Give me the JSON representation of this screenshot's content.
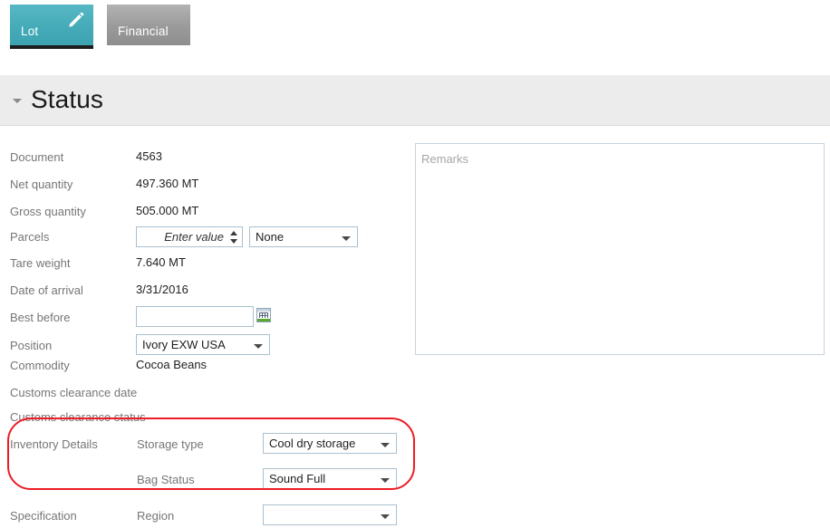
{
  "tabs": [
    {
      "label": "Lot",
      "icon": "pencil-icon",
      "active": true,
      "accent": "#45abb8"
    },
    {
      "label": "Financial",
      "active": false,
      "accent": "#9a9a9a"
    }
  ],
  "section": {
    "title": "Status",
    "caret": "chevron-down-icon",
    "expanded": true
  },
  "fields": {
    "document": {
      "label": "Document",
      "value": "4563"
    },
    "net_quantity": {
      "label": "Net quantity",
      "value": "497.360 MT"
    },
    "gross_quantity": {
      "label": "Gross quantity",
      "value": "505.000 MT"
    },
    "parcels": {
      "label": "Parcels",
      "spinner_placeholder": "Enter value",
      "spinner_value": "",
      "dropdown_value": "None"
    },
    "tare_weight": {
      "label": "Tare weight",
      "value": "7.640 MT"
    },
    "date_of_arrival": {
      "label": "Date of arrival",
      "value": "3/31/2016"
    },
    "best_before": {
      "label": "Best before",
      "value": "",
      "calendar_icon": "calendar-icon"
    },
    "position": {
      "label": "Position",
      "value": "Ivory EXW USA"
    },
    "commodity": {
      "label": "Commodity",
      "value": "Cocoa Beans"
    },
    "customs_clearance_date": {
      "label": "Customs clearance date",
      "value": ""
    },
    "customs_clearance_status": {
      "label": "Customs clearance status",
      "value": ""
    },
    "inventory_details": {
      "group_label": "Inventory Details",
      "storage_type": {
        "label": "Storage type",
        "value": "Cool dry storage"
      },
      "bag_status": {
        "label": "Bag Status",
        "value": "Sound Full"
      }
    },
    "specification": {
      "group_label": "Specification",
      "region": {
        "label": "Region",
        "value": ""
      }
    }
  },
  "remarks": {
    "placeholder": "Remarks",
    "value": ""
  },
  "annotation": {
    "color": "#ed1c24",
    "shape": "rounded-rect",
    "target": "inventory-details"
  }
}
